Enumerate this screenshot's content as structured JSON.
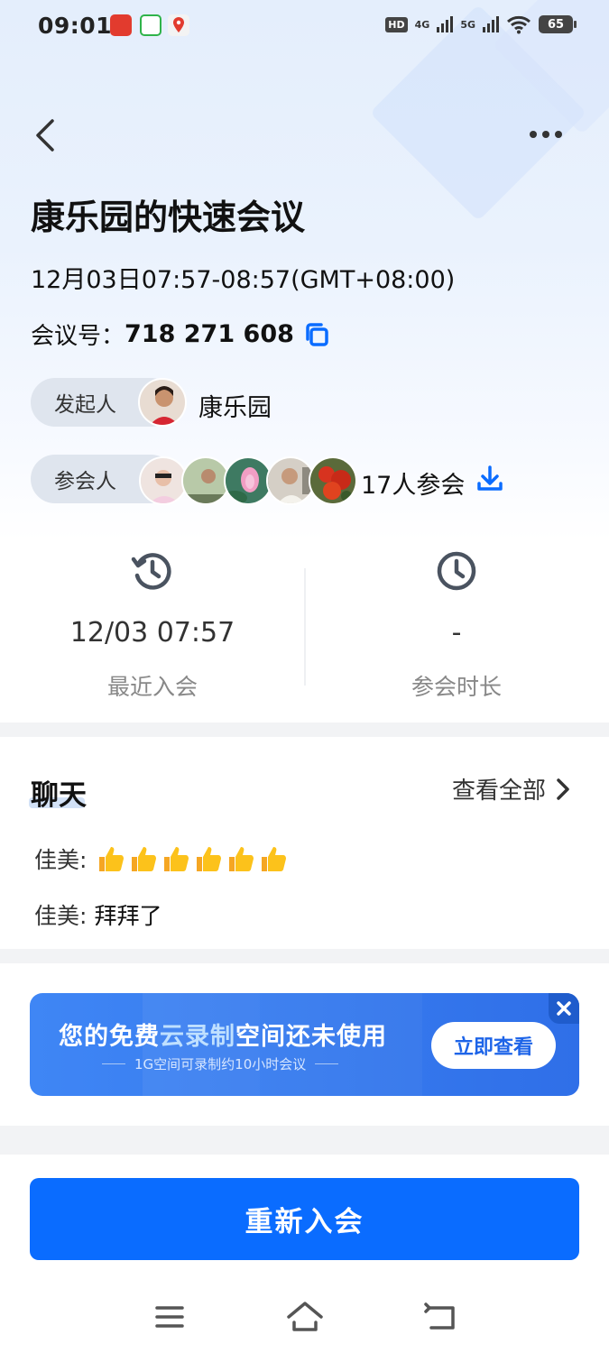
{
  "status_bar": {
    "time": "09:01",
    "hd_label": "HD",
    "sim1": "4G",
    "sim2": "5G",
    "battery": "65"
  },
  "header": {
    "title": "康乐园的快速会议",
    "time_range": "12月03日07:57-08:57(GMT+08:00)",
    "meeting_id_label": "会议号：",
    "meeting_id": "718 271 608"
  },
  "host": {
    "chip_label": "发起人",
    "name": "康乐园"
  },
  "attendees": {
    "chip_label": "参会人",
    "count_text": "17人参会"
  },
  "stats": {
    "recent_join_value": "12/03 07:57",
    "recent_join_label": "最近入会",
    "duration_value": "-",
    "duration_label": "参会时长"
  },
  "chat": {
    "title": "聊天",
    "view_all": "查看全部",
    "messages": [
      {
        "sender": "佳美:",
        "text": ""
      },
      {
        "sender": "佳美:",
        "text": "拜拜了"
      }
    ]
  },
  "banner": {
    "title_prefix": "您的免费",
    "title_highlight": "云录制",
    "title_suffix": "空间还未使用",
    "subtitle": "1G空间可录制约10小时会议",
    "button": "立即查看"
  },
  "rejoin_button": "重新入会",
  "colors": {
    "primary_blue": "#0a6cff",
    "banner_blue": "#2f6fe8",
    "chip_gray": "#dfe5ee"
  }
}
